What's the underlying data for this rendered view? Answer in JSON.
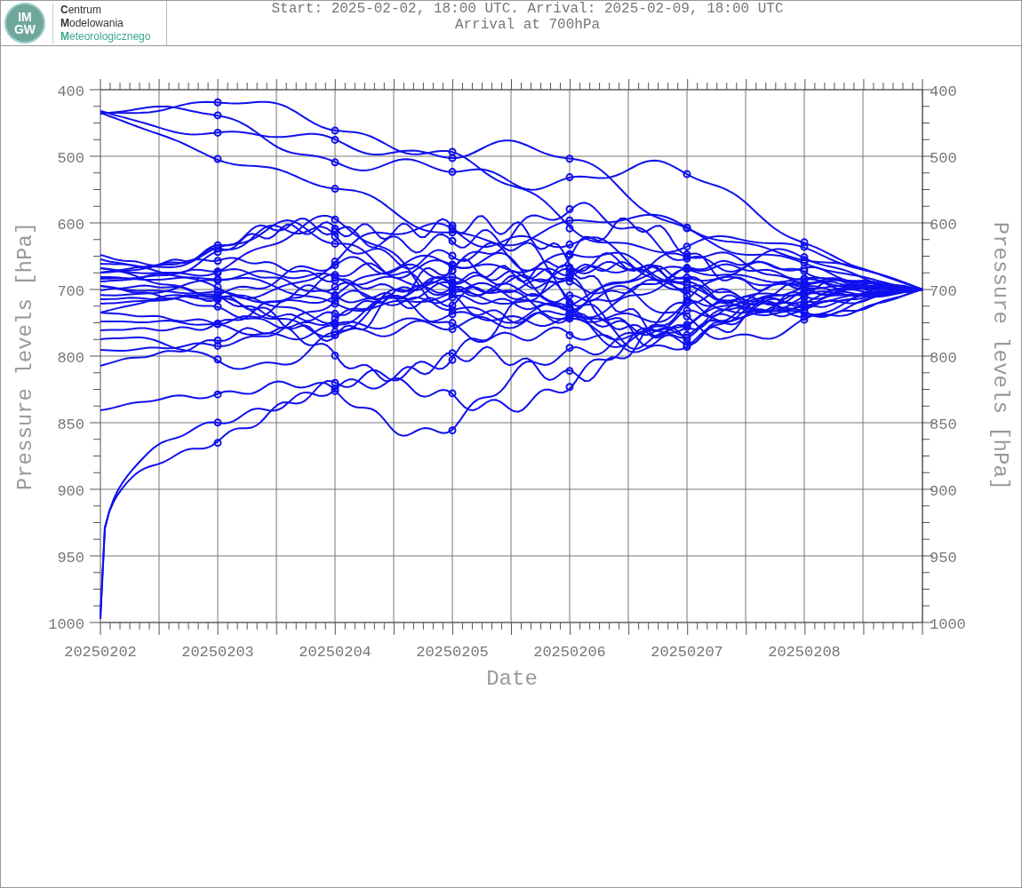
{
  "logo": {
    "mark_lines": [
      "IM",
      "GW"
    ],
    "lines": [
      "**C**entrum",
      "**M**odelowania",
      "**M**eteorologicznego"
    ]
  },
  "title": {
    "lines": [
      "Start: 2025-02-02, 18:00 UTC. Arrival: 2025-02-09, 18:00 UTC",
      "Arrival at 700hPa"
    ]
  },
  "plot": {
    "y_axis_left": {
      "title": "Pressure levels [hPa]",
      "tick_labels": [
        "400",
        "500",
        "600",
        "700",
        "800",
        "850",
        "900",
        "950",
        "1000"
      ]
    },
    "y_axis_right": {
      "title": "Pressure levels [hPa]",
      "tick_labels": [
        "400",
        "500",
        "600",
        "700",
        "800",
        "850",
        "900",
        "950",
        "1000"
      ]
    },
    "x_axis": {
      "title": "Date",
      "tick_labels": [
        "20250202",
        "20250203",
        "20250204",
        "20250205",
        "20250206",
        "20250207",
        "20250208"
      ]
    }
  }
}
